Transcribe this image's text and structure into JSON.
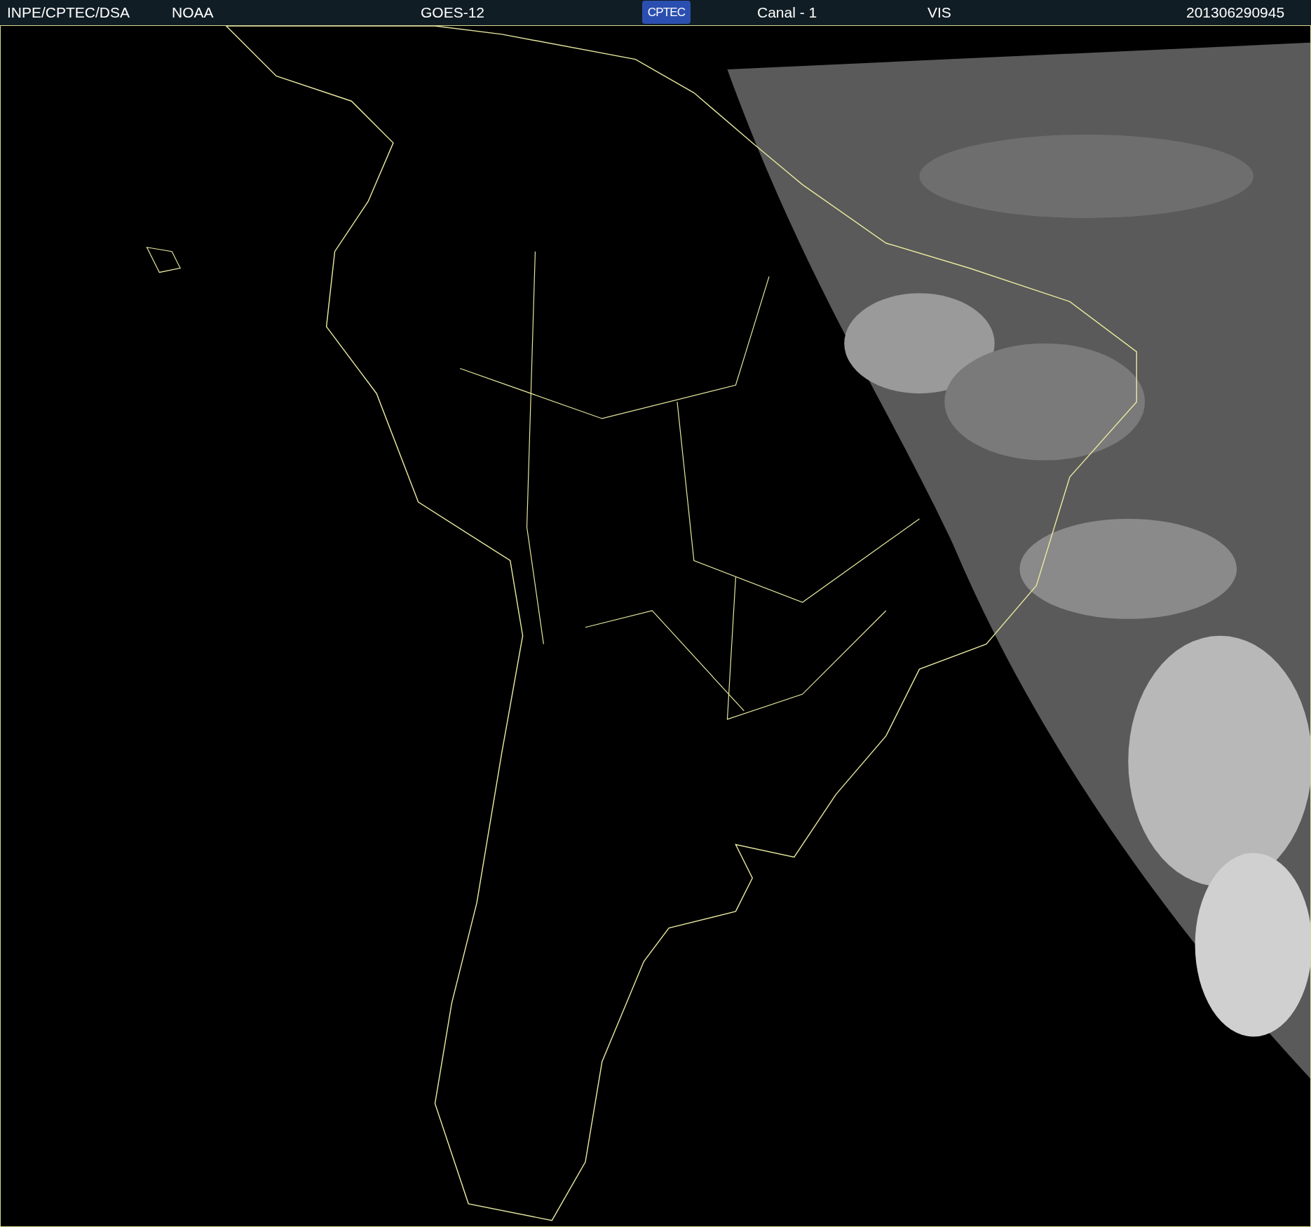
{
  "header": {
    "items": [
      {
        "kind": "text",
        "text": "INPE/CPTEC/DSA"
      },
      {
        "kind": "text",
        "text": "NOAA"
      },
      {
        "kind": "text",
        "text": "GOES-12"
      },
      {
        "kind": "logo",
        "text": "CPTEC"
      },
      {
        "kind": "text",
        "text": "Canal - 1"
      },
      {
        "kind": "text",
        "text": "VIS"
      },
      {
        "kind": "text",
        "text": "201306290945"
      }
    ]
  }
}
